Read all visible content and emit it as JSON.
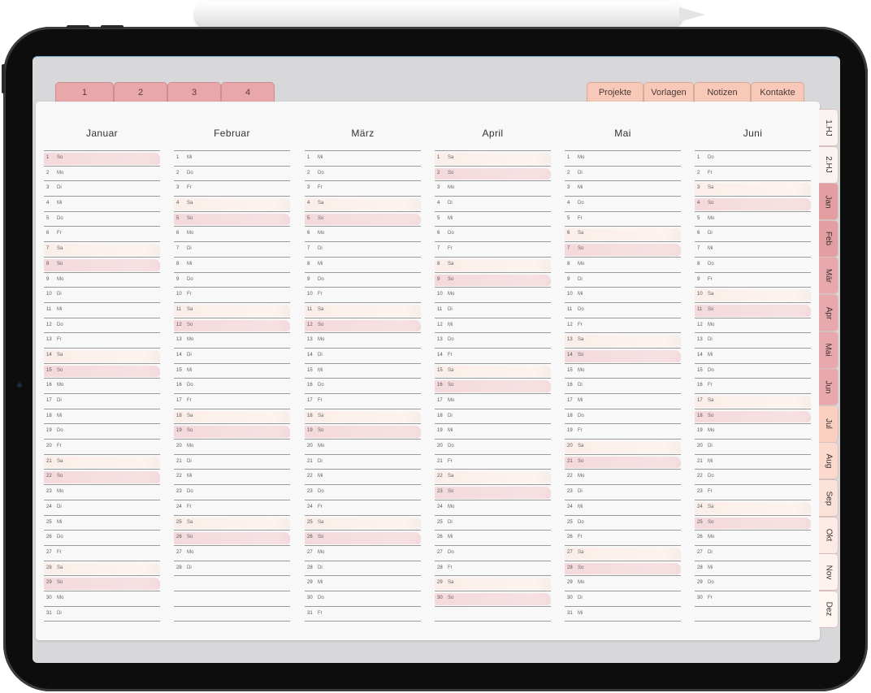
{
  "tabs": {
    "numbers": [
      "1",
      "2",
      "3",
      "4"
    ],
    "right": [
      "Projekte",
      "Vorlagen",
      "Notizen",
      "Kontakte"
    ]
  },
  "side_tabs": [
    "1.HJ",
    "2.HJ",
    "Jan",
    "Feb",
    "Mär",
    "Apr",
    "Mai",
    "Jun",
    "Jul",
    "Aug",
    "Sep",
    "Okt",
    "Nov",
    "Dez"
  ],
  "colors": {
    "saturday": "#fbeee9",
    "sunday": "#f4d9dc",
    "tab_pink": "#e8a7a9",
    "tab_peach": "#f8c9b8"
  },
  "months": [
    {
      "name": "Januar",
      "days": 31,
      "first_weekday": "So",
      "rows": 31
    },
    {
      "name": "Februar",
      "days": 28,
      "first_weekday": "Mi",
      "rows": 31
    },
    {
      "name": "März",
      "days": 31,
      "first_weekday": "Mi",
      "rows": 31
    },
    {
      "name": "April",
      "days": 30,
      "first_weekday": "Sa",
      "rows": 31
    },
    {
      "name": "Mai",
      "days": 31,
      "first_weekday": "Mo",
      "rows": 31
    },
    {
      "name": "Juni",
      "days": 30,
      "first_weekday": "Do",
      "rows": 31
    }
  ],
  "weekdays": [
    "Mo",
    "Di",
    "Mi",
    "Do",
    "Fr",
    "Sa",
    "So"
  ]
}
